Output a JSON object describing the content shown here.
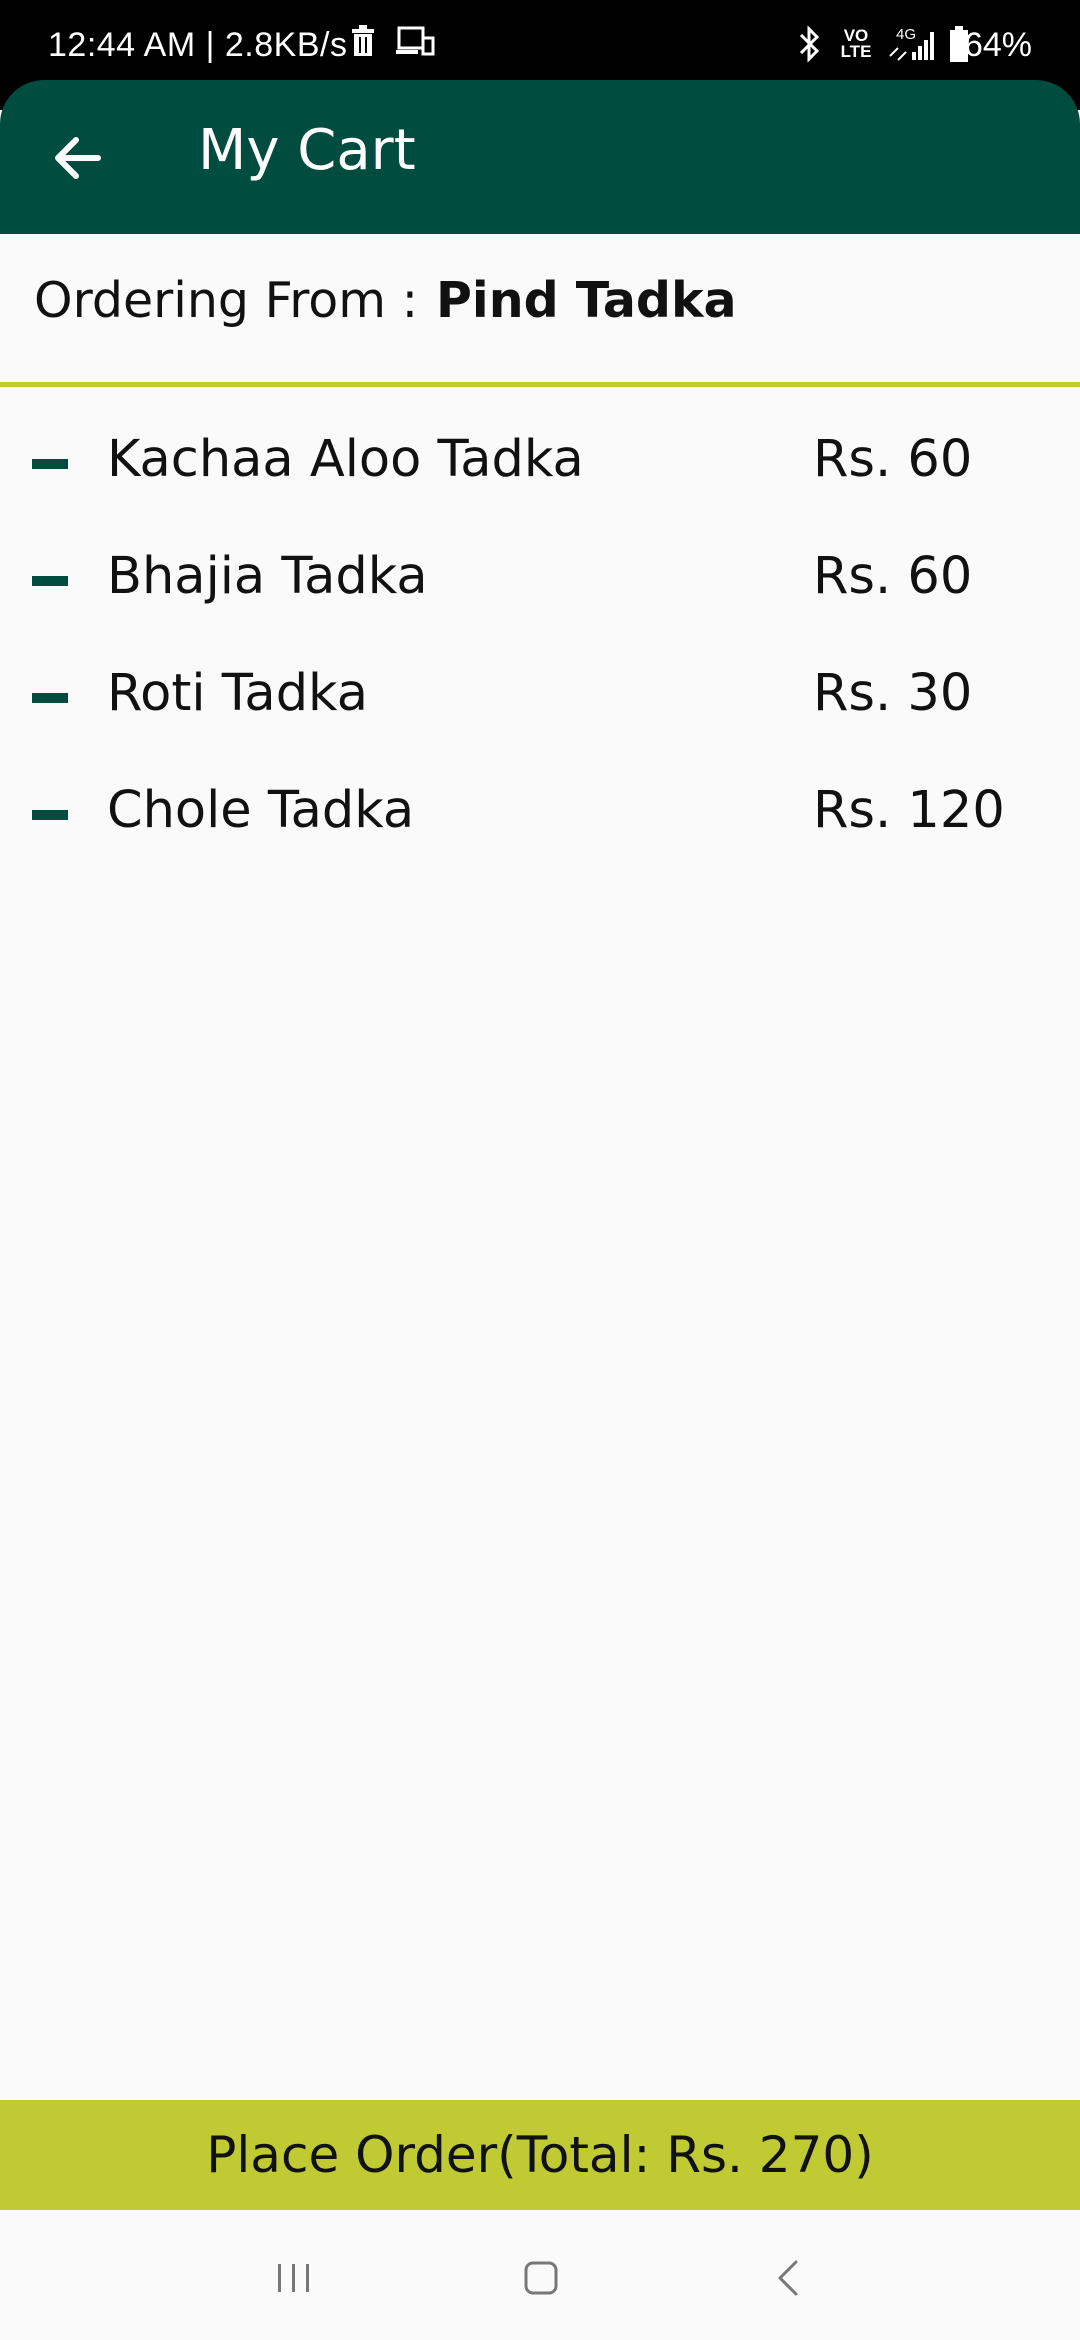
{
  "status_bar": {
    "time_speed": "12:44 AM | 2.8KB/s",
    "network_type": "4G",
    "volte": "VO LTE",
    "battery": "64%"
  },
  "header": {
    "title": "My Cart",
    "back_icon": "arrow-left-icon"
  },
  "ordering": {
    "label": "Ordering From :",
    "restaurant": "Pind Tadka"
  },
  "cart": {
    "items": [
      {
        "name": "Kachaa Aloo Tadka",
        "price": "Rs. 60"
      },
      {
        "name": "Bhajia Tadka",
        "price": "Rs. 60"
      },
      {
        "name": "Roti Tadka",
        "price": "Rs. 30"
      },
      {
        "name": "Chole Tadka",
        "price": "Rs. 120"
      }
    ]
  },
  "footer": {
    "place_order_label": "Place Order(Total: Rs. 270)"
  },
  "colors": {
    "primary": "#004d40",
    "accent": "#c0ca33"
  }
}
